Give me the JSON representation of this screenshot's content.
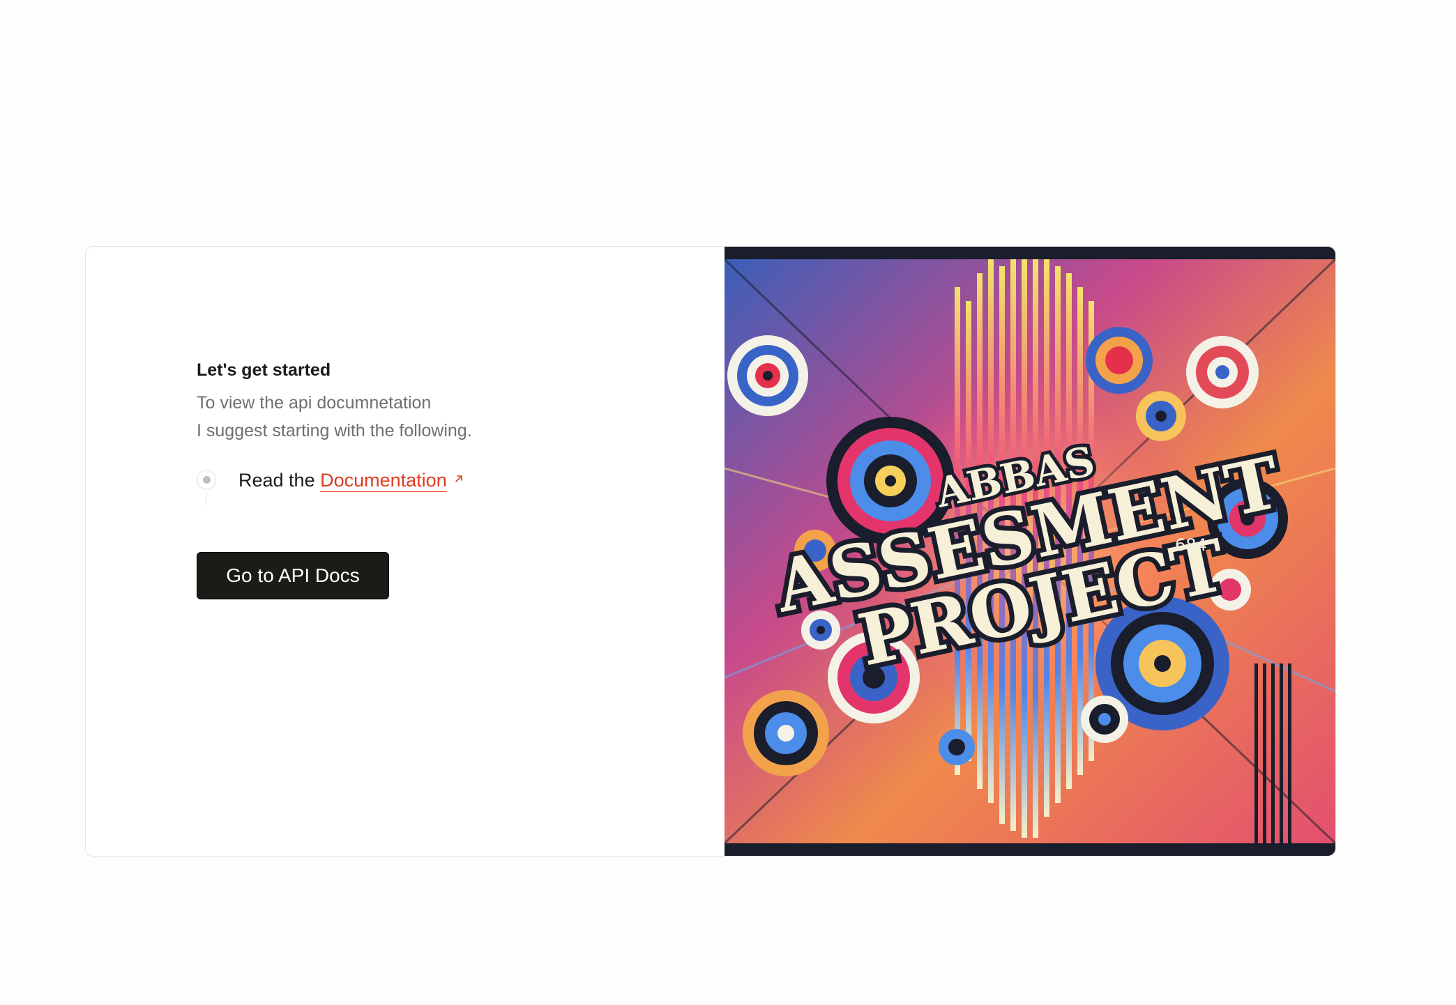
{
  "welcome": {
    "heading": "Let's get started",
    "description_line1": "To view the api documnetation",
    "description_line2": "I suggest starting with the following.",
    "step_prefix": "Read the",
    "step_link": "Documentation",
    "button_label": "Go to API Docs"
  },
  "hero_image": {
    "title_top": "ABBAS",
    "title_middle": "ASSESMENT",
    "title_bottom": "PROJECT",
    "number_text": "684"
  },
  "colors": {
    "accent_link": "#e03a1e",
    "button_bg": "#1b1b18",
    "page_bg": "#fdfdfc"
  },
  "icons": {
    "external_link": "arrow-up-right-icon",
    "step_marker": "step-dot-icon"
  }
}
